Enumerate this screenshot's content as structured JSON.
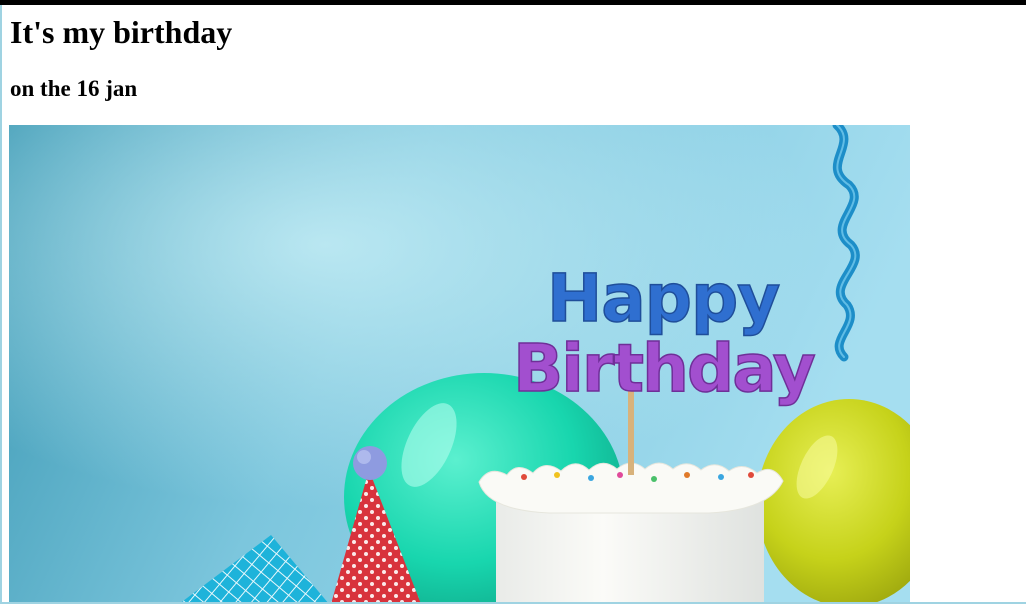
{
  "page": {
    "heading": "It's my birthday",
    "subheading": "on the 16 jan"
  },
  "photo": {
    "topper_line1": "Happy",
    "topper_line2": "Birthday",
    "colors": {
      "sky_left": "#3f9fb9",
      "sky_right": "#9fdcec",
      "balloon_green": "#19d9b2",
      "balloon_yellow": "#c9d51a",
      "hat_red": "#d9313b",
      "hat_blue": "#1fb2d8",
      "pompom": "#8e9be0",
      "streamer": "#1e8fc9",
      "cake": "#f6f6f2"
    }
  }
}
